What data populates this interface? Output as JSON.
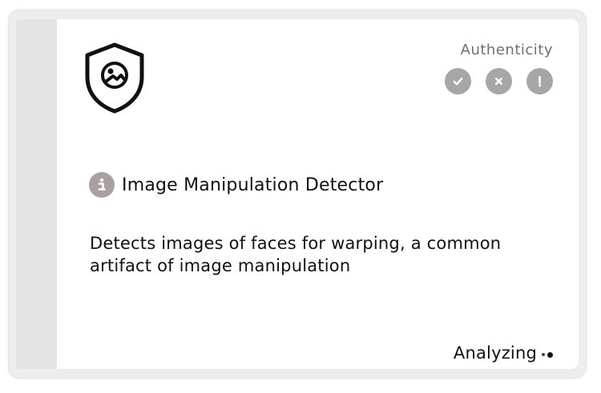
{
  "card": {
    "icon": "shield-image-icon",
    "authenticity": {
      "label": "Authenticity",
      "actions": [
        {
          "icon": "check-icon",
          "color": "#a6a6a6"
        },
        {
          "icon": "close-icon",
          "color": "#a6a6a6"
        },
        {
          "icon": "exclamation-icon",
          "color": "#a6a6a6"
        }
      ]
    },
    "title": "Image Manipulation Detector",
    "info_icon": "info-icon",
    "description": "Detects images of faces for warping, a common artifact of image manipulation",
    "status": "Analyzing"
  },
  "colors": {
    "frame": "#ededed",
    "side_strip": "#e4e4e4",
    "icon_gray": "#a6a6a6",
    "text": "#111111",
    "muted_text": "#6f6f6f"
  }
}
